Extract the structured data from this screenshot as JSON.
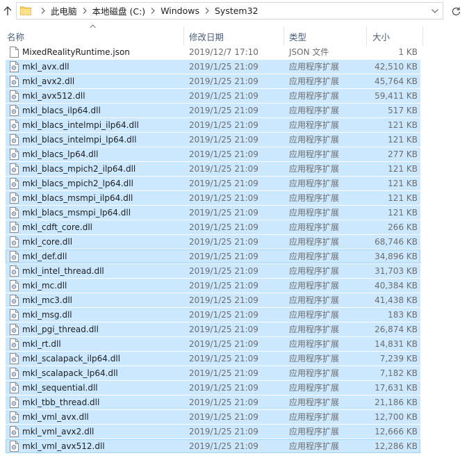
{
  "address_bar": {
    "breadcrumbs": [
      "此电脑",
      "本地磁盘 (C:)",
      "Windows",
      "System32"
    ]
  },
  "columns": {
    "name": "名称",
    "date": "修改日期",
    "type": "类型",
    "size": "大小"
  },
  "icons": {
    "up": "up-arrow-icon",
    "folder": "folder-icon",
    "separator": "chevron-right-icon",
    "dropdown": "chevron-down-icon",
    "refresh": "refresh-icon",
    "sort": "sort-ascending-icon",
    "file": "file-icon",
    "dll": "dll-file-icon"
  },
  "colors": {
    "selection": "#cce8ff",
    "focus_border": "#99d1ff",
    "header_text": "#4c607a",
    "detail_text": "#6d6d6d"
  },
  "files": [
    {
      "name": "MixedRealityRuntime.json",
      "date": "2019/12/7 17:10",
      "type": "JSON 文件",
      "size": "1 KB",
      "selected": false,
      "icon": "file"
    },
    {
      "name": "mkl_avx.dll",
      "date": "2019/1/25 21:09",
      "type": "应用程序扩展",
      "size": "42,510 KB",
      "selected": true,
      "icon": "dll"
    },
    {
      "name": "mkl_avx2.dll",
      "date": "2019/1/25 21:09",
      "type": "应用程序扩展",
      "size": "45,764 KB",
      "selected": true,
      "icon": "dll"
    },
    {
      "name": "mkl_avx512.dll",
      "date": "2019/1/25 21:09",
      "type": "应用程序扩展",
      "size": "59,411 KB",
      "selected": true,
      "icon": "dll"
    },
    {
      "name": "mkl_blacs_ilp64.dll",
      "date": "2019/1/25 21:09",
      "type": "应用程序扩展",
      "size": "517 KB",
      "selected": true,
      "icon": "dll"
    },
    {
      "name": "mkl_blacs_intelmpi_ilp64.dll",
      "date": "2019/1/25 21:09",
      "type": "应用程序扩展",
      "size": "121 KB",
      "selected": true,
      "icon": "dll"
    },
    {
      "name": "mkl_blacs_intelmpi_lp64.dll",
      "date": "2019/1/25 21:09",
      "type": "应用程序扩展",
      "size": "121 KB",
      "selected": true,
      "icon": "dll"
    },
    {
      "name": "mkl_blacs_lp64.dll",
      "date": "2019/1/25 21:09",
      "type": "应用程序扩展",
      "size": "277 KB",
      "selected": true,
      "icon": "dll"
    },
    {
      "name": "mkl_blacs_mpich2_ilp64.dll",
      "date": "2019/1/25 21:09",
      "type": "应用程序扩展",
      "size": "121 KB",
      "selected": true,
      "icon": "dll"
    },
    {
      "name": "mkl_blacs_mpich2_lp64.dll",
      "date": "2019/1/25 21:09",
      "type": "应用程序扩展",
      "size": "121 KB",
      "selected": true,
      "icon": "dll"
    },
    {
      "name": "mkl_blacs_msmpi_ilp64.dll",
      "date": "2019/1/25 21:09",
      "type": "应用程序扩展",
      "size": "121 KB",
      "selected": true,
      "icon": "dll"
    },
    {
      "name": "mkl_blacs_msmpi_lp64.dll",
      "date": "2019/1/25 21:09",
      "type": "应用程序扩展",
      "size": "121 KB",
      "selected": true,
      "icon": "dll"
    },
    {
      "name": "mkl_cdft_core.dll",
      "date": "2019/1/25 21:09",
      "type": "应用程序扩展",
      "size": "266 KB",
      "selected": true,
      "icon": "dll"
    },
    {
      "name": "mkl_core.dll",
      "date": "2019/1/25 21:09",
      "type": "应用程序扩展",
      "size": "68,746 KB",
      "selected": true,
      "icon": "dll"
    },
    {
      "name": "mkl_def.dll",
      "date": "2019/1/25 21:09",
      "type": "应用程序扩展",
      "size": "34,896 KB",
      "selected": true,
      "icon": "dll",
      "focused": true
    },
    {
      "name": "mkl_intel_thread.dll",
      "date": "2019/1/25 21:09",
      "type": "应用程序扩展",
      "size": "31,703 KB",
      "selected": true,
      "icon": "dll"
    },
    {
      "name": "mkl_mc.dll",
      "date": "2019/1/25 21:09",
      "type": "应用程序扩展",
      "size": "40,384 KB",
      "selected": true,
      "icon": "dll"
    },
    {
      "name": "mkl_mc3.dll",
      "date": "2019/1/25 21:09",
      "type": "应用程序扩展",
      "size": "41,438 KB",
      "selected": true,
      "icon": "dll"
    },
    {
      "name": "mkl_msg.dll",
      "date": "2019/1/25 21:09",
      "type": "应用程序扩展",
      "size": "183 KB",
      "selected": true,
      "icon": "dll"
    },
    {
      "name": "mkl_pgi_thread.dll",
      "date": "2019/1/25 21:09",
      "type": "应用程序扩展",
      "size": "26,874 KB",
      "selected": true,
      "icon": "dll"
    },
    {
      "name": "mkl_rt.dll",
      "date": "2019/1/25 21:09",
      "type": "应用程序扩展",
      "size": "14,831 KB",
      "selected": true,
      "icon": "dll"
    },
    {
      "name": "mkl_scalapack_ilp64.dll",
      "date": "2019/1/25 21:09",
      "type": "应用程序扩展",
      "size": "7,239 KB",
      "selected": true,
      "icon": "dll"
    },
    {
      "name": "mkl_scalapack_lp64.dll",
      "date": "2019/1/25 21:09",
      "type": "应用程序扩展",
      "size": "7,182 KB",
      "selected": true,
      "icon": "dll"
    },
    {
      "name": "mkl_sequential.dll",
      "date": "2019/1/25 21:09",
      "type": "应用程序扩展",
      "size": "17,631 KB",
      "selected": true,
      "icon": "dll"
    },
    {
      "name": "mkl_tbb_thread.dll",
      "date": "2019/1/25 21:09",
      "type": "应用程序扩展",
      "size": "21,186 KB",
      "selected": true,
      "icon": "dll"
    },
    {
      "name": "mkl_vml_avx.dll",
      "date": "2019/1/25 21:09",
      "type": "应用程序扩展",
      "size": "12,700 KB",
      "selected": true,
      "icon": "dll"
    },
    {
      "name": "mkl_vml_avx2.dll",
      "date": "2019/1/25 21:09",
      "type": "应用程序扩展",
      "size": "12,666 KB",
      "selected": true,
      "icon": "dll"
    },
    {
      "name": "mkl_vml_avx512.dll",
      "date": "2019/1/25 21:09",
      "type": "应用程序扩展",
      "size": "12,286 KB",
      "selected": true,
      "icon": "dll",
      "focused": true
    }
  ]
}
